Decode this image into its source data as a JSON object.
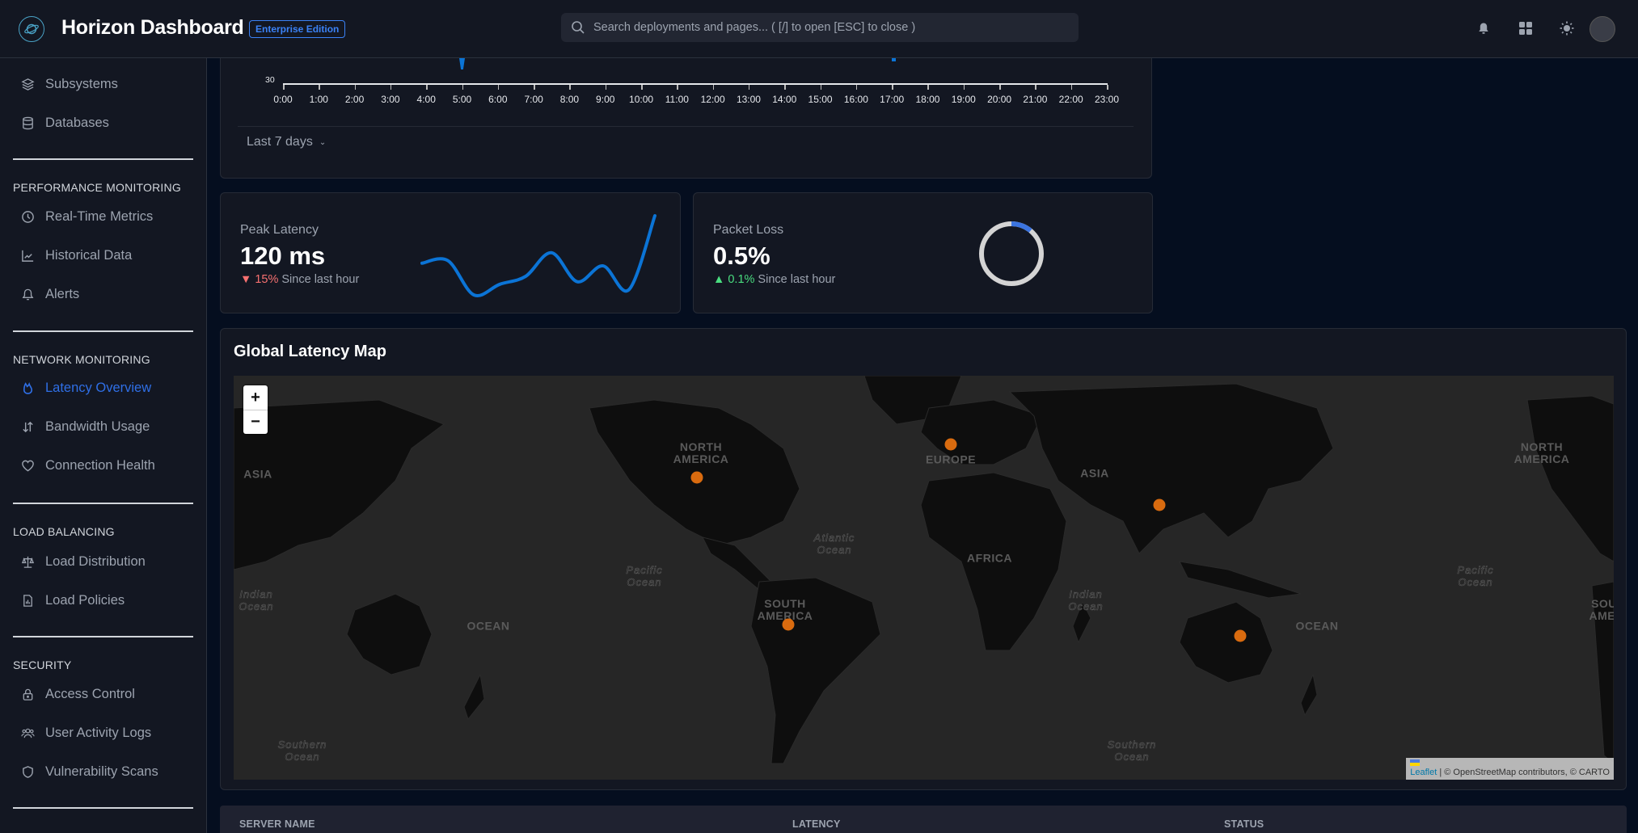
{
  "header": {
    "app_title": "Horizon Dashboard",
    "edition_badge": "Enterprise Edition",
    "search_placeholder": "Search deployments and pages... ( [/] to open [ESC] to close )",
    "icons": [
      "bell-icon",
      "grid-icon",
      "sun-icon",
      "avatar"
    ]
  },
  "sidebar": {
    "top_items": [
      {
        "label": "Subsystems",
        "icon": "layers-icon"
      },
      {
        "label": "Databases",
        "icon": "database-icon"
      }
    ],
    "sections": [
      {
        "title": "PERFORMANCE MONITORING",
        "items": [
          {
            "label": "Real-Time Metrics",
            "icon": "clock-icon"
          },
          {
            "label": "Historical Data",
            "icon": "chart-line-icon"
          },
          {
            "label": "Alerts",
            "icon": "bell-icon"
          }
        ]
      },
      {
        "title": "NETWORK MONITORING",
        "items": [
          {
            "label": "Latency Overview",
            "icon": "flame-icon",
            "active": true
          },
          {
            "label": "Bandwidth Usage",
            "icon": "arrows-up-down-icon"
          },
          {
            "label": "Connection Health",
            "icon": "heart-icon"
          }
        ]
      },
      {
        "title": "LOAD BALANCING",
        "items": [
          {
            "label": "Load Distribution",
            "icon": "scale-icon"
          },
          {
            "label": "Load Policies",
            "icon": "report-icon"
          }
        ]
      },
      {
        "title": "SECURITY",
        "items": [
          {
            "label": "Access Control",
            "icon": "lock-icon"
          },
          {
            "label": "User Activity Logs",
            "icon": "users-icon"
          },
          {
            "label": "Vulnerability Scans",
            "icon": "shield-icon"
          }
        ]
      }
    ]
  },
  "latency_chart": {
    "y_visible_tick": "30",
    "x_ticks": [
      "0:00",
      "1:00",
      "2:00",
      "3:00",
      "4:00",
      "5:00",
      "6:00",
      "7:00",
      "8:00",
      "9:00",
      "10:00",
      "11:00",
      "12:00",
      "13:00",
      "14:00",
      "15:00",
      "16:00",
      "17:00",
      "18:00",
      "19:00",
      "20:00",
      "21:00",
      "22:00",
      "23:00"
    ],
    "range_select": "Last 7 days",
    "accent": "#0b74d6"
  },
  "stats": {
    "peak_latency": {
      "title": "Peak Latency",
      "value": "120 ms",
      "delta": "15%",
      "delta_dir": "down",
      "delta_suffix": "Since last hour",
      "sparkline": [
        62,
        64,
        38,
        46,
        52,
        70,
        48,
        60,
        42,
        98
      ]
    },
    "packet_loss": {
      "title": "Packet Loss",
      "value": "0.5%",
      "delta": "0.1%",
      "delta_dir": "up",
      "delta_suffix": "Since last hour",
      "gauge_fraction": 0.05
    }
  },
  "map": {
    "title": "Global Latency Map",
    "zoom_in": "+",
    "zoom_out": "−",
    "continent_labels": [
      {
        "text": "ASIA"
      },
      {
        "text": "NORTH\nAMERICA"
      },
      {
        "text": "EUROPE"
      },
      {
        "text": "ASIA"
      },
      {
        "text": "NORTH\nAMERICA"
      },
      {
        "text": "AFRICA"
      },
      {
        "text": "SOUTH\nAMERICA"
      },
      {
        "text": "OCEAN"
      },
      {
        "text": "OCEAN"
      },
      {
        "text": "SOU\nAMEI"
      }
    ],
    "ocean_labels": [
      "Indian\nOcean",
      "Pacific\nOcean",
      "Atlantic\nOcean",
      "Indian\nOcean",
      "Pacific\nOcean",
      "Southern\nOcean",
      "Southern\nOcean"
    ],
    "markers": [
      "North America",
      "Europe",
      "Asia",
      "South America",
      "Australia"
    ],
    "marker_color": "#d96b0f",
    "attribution_link": "Leaflet",
    "attribution_text": " | © OpenStreetMap contributors, © CARTO"
  },
  "table": {
    "columns": [
      "SERVER NAME",
      "LATENCY",
      "STATUS"
    ]
  }
}
